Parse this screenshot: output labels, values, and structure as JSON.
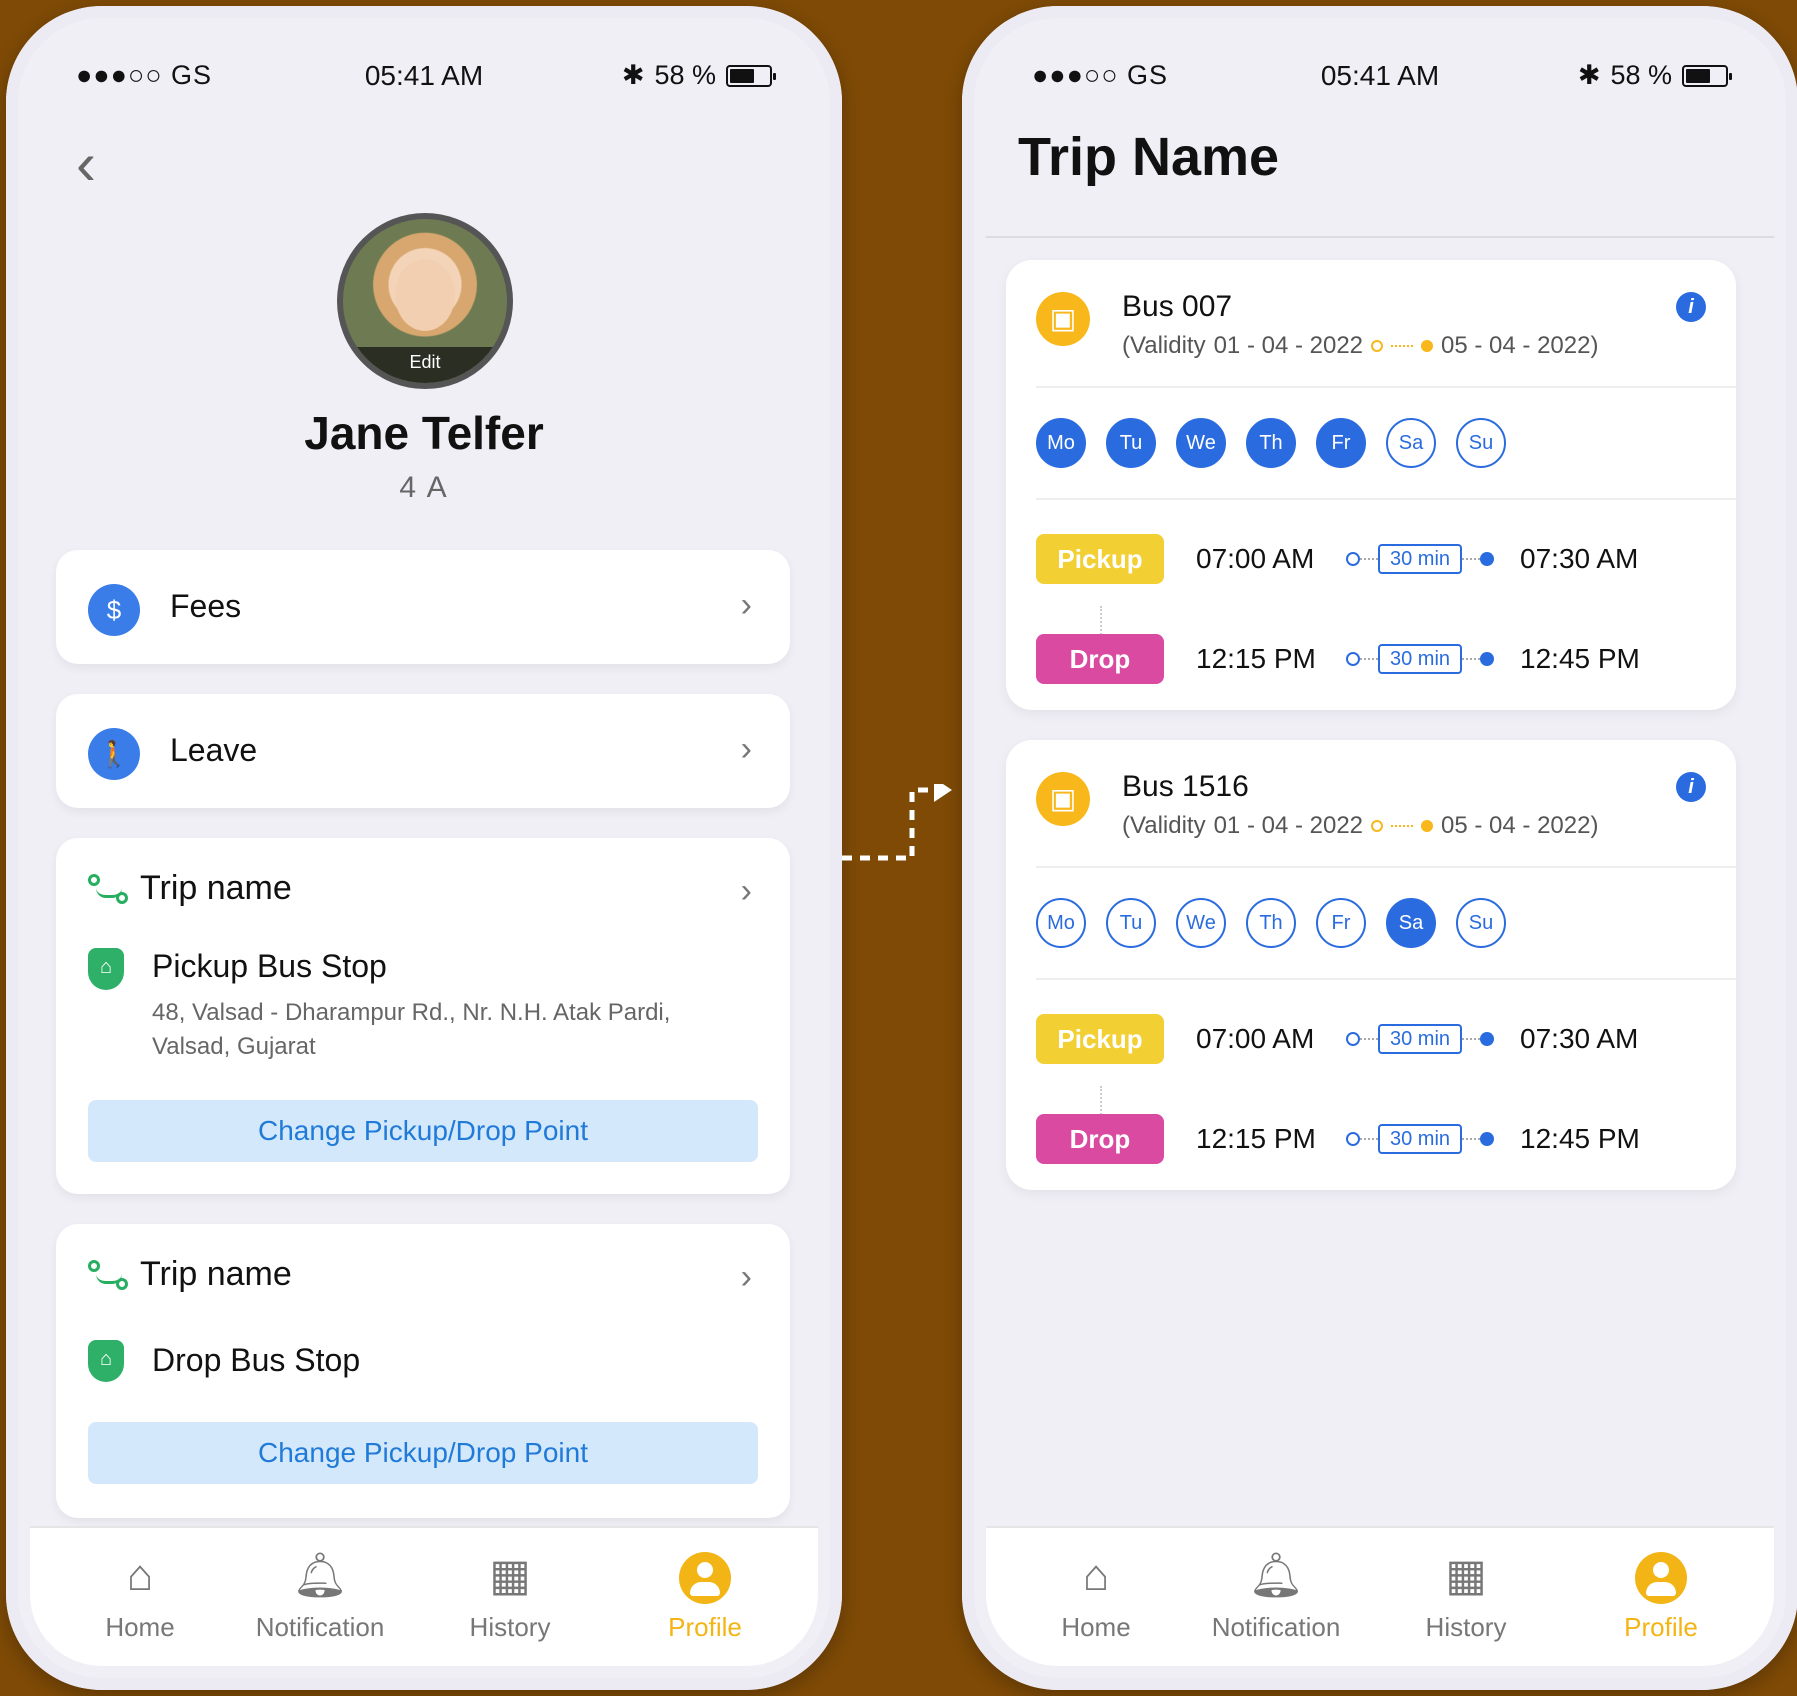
{
  "status": {
    "carrier": "●●●○○ GS",
    "time": "05:41 AM",
    "battery": "58 %"
  },
  "profile": {
    "edit_label": "Edit",
    "name": "Jane Telfer",
    "grade": "4 A",
    "menu": [
      {
        "label": "Fees"
      },
      {
        "label": "Leave"
      }
    ],
    "trips": [
      {
        "title": "Trip name",
        "stop_title": "Pickup Bus Stop",
        "address": "48, Valsad - Dharampur Rd., Nr. N.H. Atak Pardi, Valsad, Gujarat",
        "button": "Change Pickup/Drop Point"
      },
      {
        "title": "Trip name",
        "stop_title": "Drop Bus Stop",
        "button": "Change Pickup/Drop Point"
      }
    ]
  },
  "trip_page": {
    "title": "Trip Name",
    "buses": [
      {
        "name": "Bus 007",
        "validity_prefix": "(Validity",
        "from": "01 - 04 - 2022",
        "to": "05 - 04 - 2022)",
        "days": [
          {
            "label": "Mo",
            "active": true
          },
          {
            "label": "Tu",
            "active": true
          },
          {
            "label": "We",
            "active": true
          },
          {
            "label": "Th",
            "active": true
          },
          {
            "label": "Fr",
            "active": true
          },
          {
            "label": "Sa",
            "active": false
          },
          {
            "label": "Su",
            "active": false
          }
        ],
        "pickup": {
          "tag": "Pickup",
          "start": "07:00 AM",
          "duration": "30 min",
          "end": "07:30 AM"
        },
        "drop": {
          "tag": "Drop",
          "start": "12:15 PM",
          "duration": "30 min",
          "end": "12:45 PM"
        }
      },
      {
        "name": "Bus 1516",
        "validity_prefix": "(Validity",
        "from": "01 - 04 - 2022",
        "to": "05 - 04 - 2022)",
        "days": [
          {
            "label": "Mo",
            "active": false
          },
          {
            "label": "Tu",
            "active": false
          },
          {
            "label": "We",
            "active": false
          },
          {
            "label": "Th",
            "active": false
          },
          {
            "label": "Fr",
            "active": false
          },
          {
            "label": "Sa",
            "active": true
          },
          {
            "label": "Su",
            "active": false
          }
        ],
        "pickup": {
          "tag": "Pickup",
          "start": "07:00 AM",
          "duration": "30 min",
          "end": "07:30 AM"
        },
        "drop": {
          "tag": "Drop",
          "start": "12:15 PM",
          "duration": "30 min",
          "end": "12:45 PM"
        }
      }
    ]
  },
  "tabs": [
    {
      "label": "Home",
      "icon": "home-icon"
    },
    {
      "label": "Notification",
      "icon": "bell-icon"
    },
    {
      "label": "History",
      "icon": "calendar-icon"
    },
    {
      "label": "Profile",
      "icon": "user-icon",
      "active": true
    }
  ],
  "colors": {
    "accent": "#f3b516",
    "primary_blue": "#2a6ce0",
    "pickup": "#f2cf33",
    "drop": "#d94aa0",
    "background": "#7e4a06"
  }
}
